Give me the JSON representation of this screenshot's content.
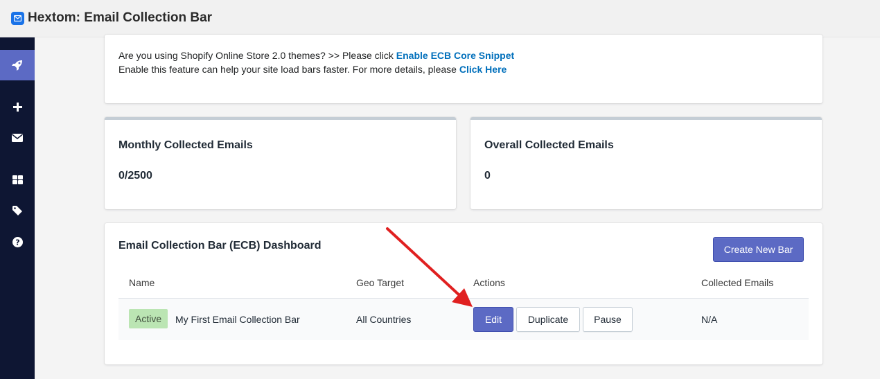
{
  "app": {
    "title": "Hextom: Email Collection Bar",
    "icon": "envelope-icon",
    "accent": "#1a73e8"
  },
  "sidebar": {
    "items": [
      {
        "icon": "rocket-icon",
        "active": true
      },
      {
        "icon": "plus-icon",
        "active": false
      },
      {
        "icon": "envelope-icon",
        "active": false
      },
      {
        "icon": "grid-icon",
        "active": false
      },
      {
        "icon": "tag-icon",
        "active": false
      },
      {
        "icon": "help-icon",
        "active": false
      }
    ],
    "bg_color": "#0e1633",
    "active_color": "#5c6ac4"
  },
  "notice": {
    "line1_text": "Are you using Shopify Online Store 2.0 themes? >> Please click ",
    "line1_link": "Enable ECB Core Snippet",
    "line2_text": "Enable this feature can help your site load bars faster. For more details, please ",
    "line2_link": "Click Here"
  },
  "stats": {
    "monthly": {
      "title": "Monthly Collected Emails",
      "value": "0/2500"
    },
    "overall": {
      "title": "Overall Collected Emails",
      "value": "0"
    }
  },
  "dashboard": {
    "title": "Email Collection Bar (ECB) Dashboard",
    "create_button": "Create New Bar",
    "columns": [
      "Name",
      "Geo Target",
      "Actions",
      "Collected Emails"
    ],
    "rows": [
      {
        "status": "Active",
        "name": "My First Email Collection Bar",
        "geo_target": "All Countries",
        "actions": {
          "edit": "Edit",
          "duplicate": "Duplicate",
          "pause": "Pause"
        },
        "collected_emails": "N/A"
      }
    ]
  },
  "annotation": {
    "arrow_color": "#e02020",
    "points_to": "edit-button"
  }
}
